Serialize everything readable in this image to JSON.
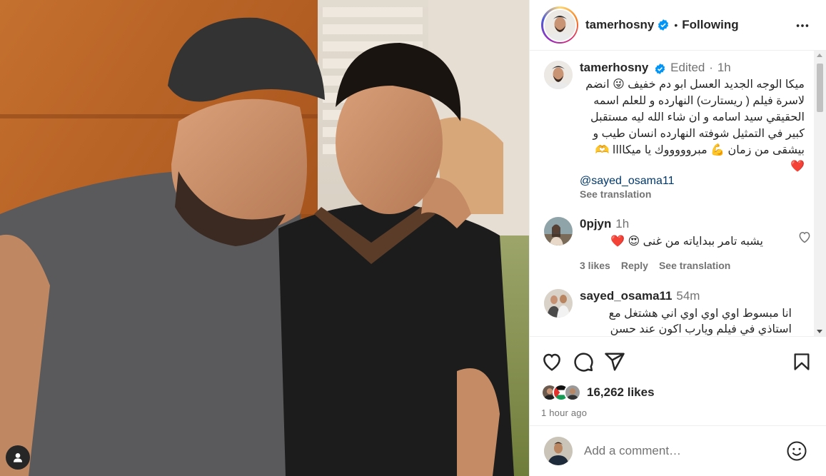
{
  "header": {
    "username": "tamerhosny",
    "separator": "•",
    "follow_state": "Following",
    "more_icon": "more-horizontal-icon"
  },
  "caption": {
    "username": "tamerhosny",
    "edited": "Edited",
    "separator": "·",
    "time": "1h",
    "text": "ميكا الوجه الجديد العسل ابو دم خفيف 😜 انضم لاسرة فيلم ( ريستارت) النهارده و للعلم اسمه الحقيقي سيد اسامه و ان شاء الله ليه مستقبل كبير في التمثيل شوفته النهارده انسان طيب و بيشقى من زمان 💪 مبروووووك يا ميكاااا 🫶 ❤️",
    "mention": "@sayed_osama11",
    "see_translation": "See translation"
  },
  "comments": [
    {
      "username": "0pjyn",
      "time": "1h",
      "text": "يشبه تامر ببداياته من غنى 😍 ❤️",
      "likes": "3 likes",
      "reply": "Reply",
      "see_translation": "See translation"
    },
    {
      "username": "sayed_osama11",
      "time": "54m",
      "text": "انا مبسوط اوي اوي اوي اني هشتغل مع استاذي في فيلم ويارب اكون عند حسن ظنك"
    }
  ],
  "actions": {
    "like_icon": "heart-icon",
    "comment_icon": "comment-icon",
    "share_icon": "paper-plane-icon",
    "save_icon": "bookmark-icon",
    "likes_count": "16,262 likes",
    "time_ago": "1 hour ago"
  },
  "add_comment": {
    "placeholder": "Add a comment…",
    "emoji_icon": "emoji-icon"
  },
  "colors": {
    "verified": "#0095f6",
    "muted": "#737373",
    "link": "#00376b",
    "heart": "#ed4956"
  }
}
